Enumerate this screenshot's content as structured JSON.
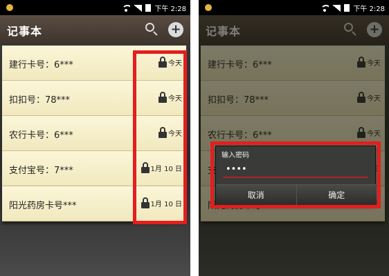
{
  "status_bar": {
    "time": "下午 2:28"
  },
  "app": {
    "title": "记事本"
  },
  "notes": [
    {
      "title": "建行卡号：6***",
      "date": "今天"
    },
    {
      "title": "扣扣号：78***",
      "date": "今天"
    },
    {
      "title": "农行卡号：6***",
      "date": "今天"
    },
    {
      "title": "支付宝号：7***",
      "date": "1月 10 日"
    },
    {
      "title": "阳光药房卡号***",
      "date": "1月 10 日"
    }
  ],
  "password_dialog": {
    "title": "输入密码",
    "value": "••••",
    "cancel_label": "取消",
    "confirm_label": "确定"
  },
  "colors": {
    "highlight": "#e41e1e",
    "appbar": "#4a3f37",
    "note_bg": "#f7f0cc"
  }
}
